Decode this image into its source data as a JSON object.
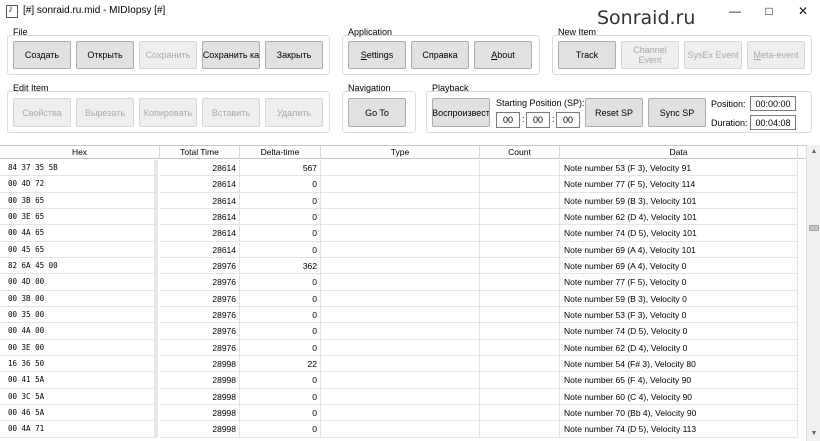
{
  "window": {
    "title": "[#] sonraid.ru.mid - MIDIopsy [#]",
    "minimize_icon": "—",
    "maximize_icon": "□",
    "close_icon": "✕",
    "watermark": "Sonraid.ru"
  },
  "groups": {
    "file": {
      "title": "File",
      "buttons": [
        {
          "label": "Создать",
          "enabled": true
        },
        {
          "label": "Открыть",
          "enabled": true
        },
        {
          "label": "Сохранить",
          "enabled": false
        },
        {
          "label": "Сохранить ка",
          "enabled": true
        },
        {
          "label": "Закрыть",
          "enabled": true
        }
      ]
    },
    "application": {
      "title": "Application",
      "buttons": [
        {
          "label": "Settings",
          "enabled": true
        },
        {
          "label": "Справка",
          "enabled": true
        },
        {
          "label": "About",
          "enabled": true
        }
      ]
    },
    "new_item": {
      "title": "New Item",
      "buttons": [
        {
          "label": "Track",
          "enabled": true
        },
        {
          "label": "Channel Event",
          "enabled": false
        },
        {
          "label": "SysEx Event",
          "enabled": false
        },
        {
          "label": "Meta-event",
          "enabled": false
        }
      ]
    },
    "edit_item": {
      "title": "Edit Item",
      "buttons": [
        {
          "label": "Свойства",
          "enabled": false
        },
        {
          "label": "Вырезать",
          "enabled": false
        },
        {
          "label": "Копировать",
          "enabled": false
        },
        {
          "label": "Вставить",
          "enabled": false
        },
        {
          "label": "Удалить",
          "enabled": false
        }
      ]
    },
    "navigation": {
      "title": "Navigation",
      "goto_label": "Go To"
    },
    "playback": {
      "title": "Playback",
      "play_label": "Воспроизвест",
      "starting_position_label": "Starting Position (SP):",
      "sp_hours": "00",
      "sp_minutes": "00",
      "sp_seconds": "00",
      "sep": ":",
      "reset_sp_label": "Reset SP",
      "sync_sp_label": "Sync SP",
      "position_label": "Position:",
      "position_value": "00:00:00",
      "duration_label": "Duration:",
      "duration_value": "00:04:08"
    }
  },
  "table": {
    "columns": [
      "Hex",
      "Total Time",
      "Delta-time",
      "Type",
      "Count",
      "Data"
    ],
    "rows": [
      {
        "hex": "84 37 35 5B",
        "total": "28614",
        "delta": "567",
        "type": "",
        "count": "",
        "data": "Note number 53 (F 3), Velocity 91"
      },
      {
        "hex": "00 4D 72",
        "total": "28614",
        "delta": "0",
        "type": "",
        "count": "",
        "data": "Note number 77 (F 5), Velocity 114"
      },
      {
        "hex": "00 3B 65",
        "total": "28614",
        "delta": "0",
        "type": "",
        "count": "",
        "data": "Note number 59 (B 3), Velocity 101"
      },
      {
        "hex": "00 3E 65",
        "total": "28614",
        "delta": "0",
        "type": "",
        "count": "",
        "data": "Note number 62 (D 4), Velocity 101"
      },
      {
        "hex": "00 4A 65",
        "total": "28614",
        "delta": "0",
        "type": "",
        "count": "",
        "data": "Note number 74 (D 5), Velocity 101"
      },
      {
        "hex": "00 45 65",
        "total": "28614",
        "delta": "0",
        "type": "",
        "count": "",
        "data": "Note number 69 (A 4), Velocity 101"
      },
      {
        "hex": "82 6A 45 00",
        "total": "28976",
        "delta": "362",
        "type": "",
        "count": "",
        "data": "Note number 69 (A 4), Velocity 0"
      },
      {
        "hex": "00 4D 00",
        "total": "28976",
        "delta": "0",
        "type": "",
        "count": "",
        "data": "Note number 77 (F 5), Velocity 0"
      },
      {
        "hex": "00 3B 00",
        "total": "28976",
        "delta": "0",
        "type": "",
        "count": "",
        "data": "Note number 59 (B 3), Velocity 0"
      },
      {
        "hex": "00 35 00",
        "total": "28976",
        "delta": "0",
        "type": "",
        "count": "",
        "data": "Note number 53 (F 3), Velocity 0"
      },
      {
        "hex": "00 4A 00",
        "total": "28976",
        "delta": "0",
        "type": "",
        "count": "",
        "data": "Note number 74 (D 5), Velocity 0"
      },
      {
        "hex": "00 3E 00",
        "total": "28976",
        "delta": "0",
        "type": "",
        "count": "",
        "data": "Note number 62 (D 4), Velocity 0"
      },
      {
        "hex": "16 36 50",
        "total": "28998",
        "delta": "22",
        "type": "",
        "count": "",
        "data": "Note number 54 (F# 3), Velocity 80"
      },
      {
        "hex": "00 41 5A",
        "total": "28998",
        "delta": "0",
        "type": "",
        "count": "",
        "data": "Note number 65 (F 4), Velocity 90"
      },
      {
        "hex": "00 3C 5A",
        "total": "28998",
        "delta": "0",
        "type": "",
        "count": "",
        "data": "Note number 60 (C 4), Velocity 90"
      },
      {
        "hex": "00 46 5A",
        "total": "28998",
        "delta": "0",
        "type": "",
        "count": "",
        "data": "Note number 70 (Bb 4), Velocity 90"
      },
      {
        "hex": "00 4A 71",
        "total": "28998",
        "delta": "0",
        "type": "",
        "count": "",
        "data": "Note number 74 (D 5), Velocity 113"
      }
    ]
  },
  "scrollbar": {
    "up_icon": "▲",
    "down_icon": "▼"
  }
}
